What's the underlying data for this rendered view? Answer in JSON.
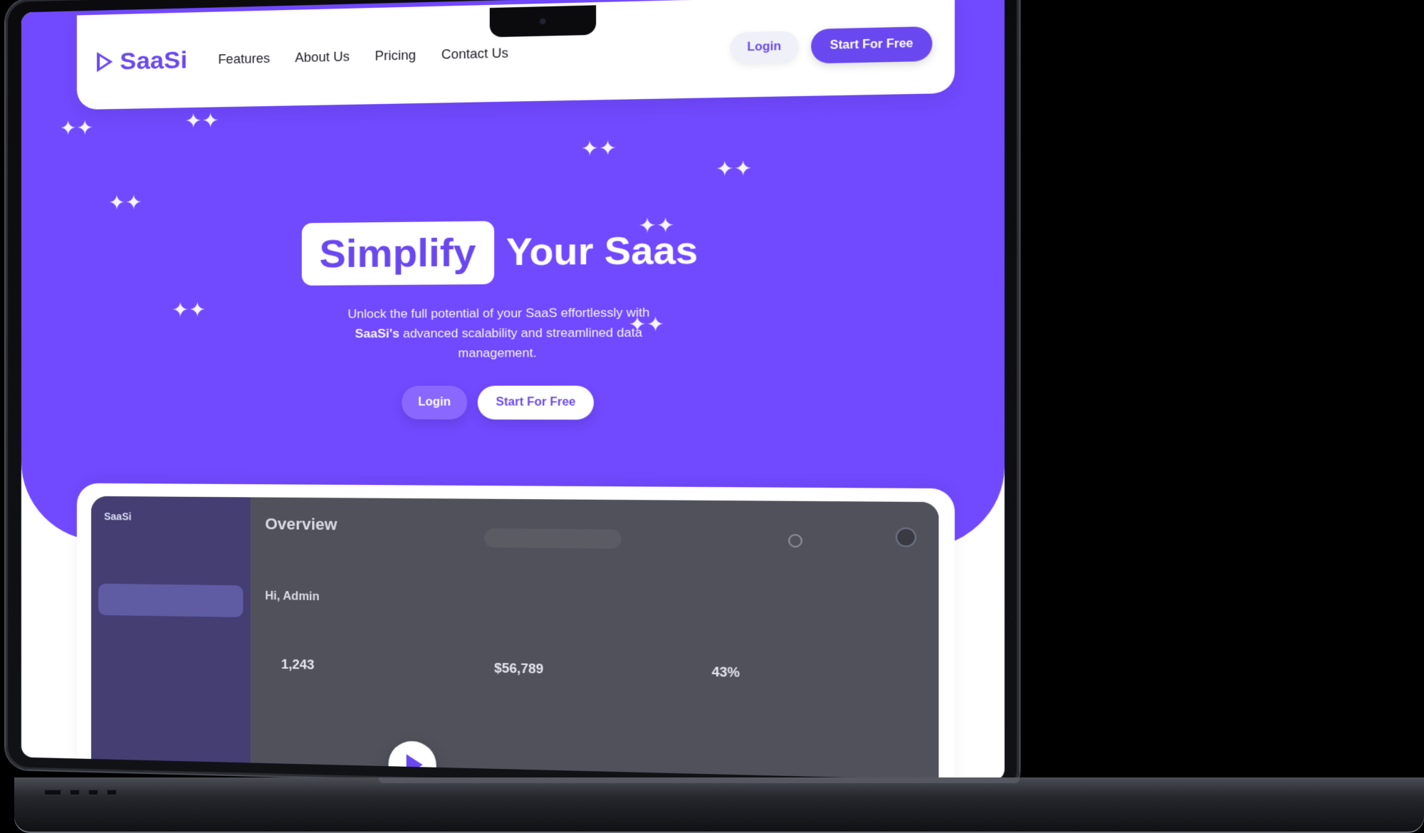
{
  "brand": {
    "name": "SaaSi"
  },
  "navigation": {
    "items": [
      {
        "label": "Features"
      },
      {
        "label": "About Us"
      },
      {
        "label": "Pricing"
      },
      {
        "label": "Contact Us"
      }
    ],
    "actions": {
      "login": "Login",
      "start_free": "Start For Free"
    }
  },
  "hero": {
    "headline_highlight": "Simplify",
    "headline_rest": "Your Saas",
    "subtext_before": "Unlock the full potential of your SaaS effortlessly with",
    "subtext_brand": "SaaSi's",
    "subtext_after": "advanced scalability and streamlined data management.",
    "actions": {
      "login": "Login",
      "start_free": "Start For Free"
    }
  },
  "dashboard_preview": {
    "sidebar_brand": "SaaSi",
    "page_title": "Overview",
    "greeting": "Hi, Admin",
    "stats": [
      {
        "value": "1,243"
      },
      {
        "value": "$56,789"
      },
      {
        "value": "43%"
      }
    ]
  },
  "colors": {
    "primary": "#6a48ef",
    "hero_bg": "#7149ff",
    "white": "#ffffff",
    "dark_text": "#1d1d26"
  },
  "icons": {
    "logo": "play-logo-icon",
    "sparkle": "sparkle-icon",
    "play": "play-icon"
  }
}
